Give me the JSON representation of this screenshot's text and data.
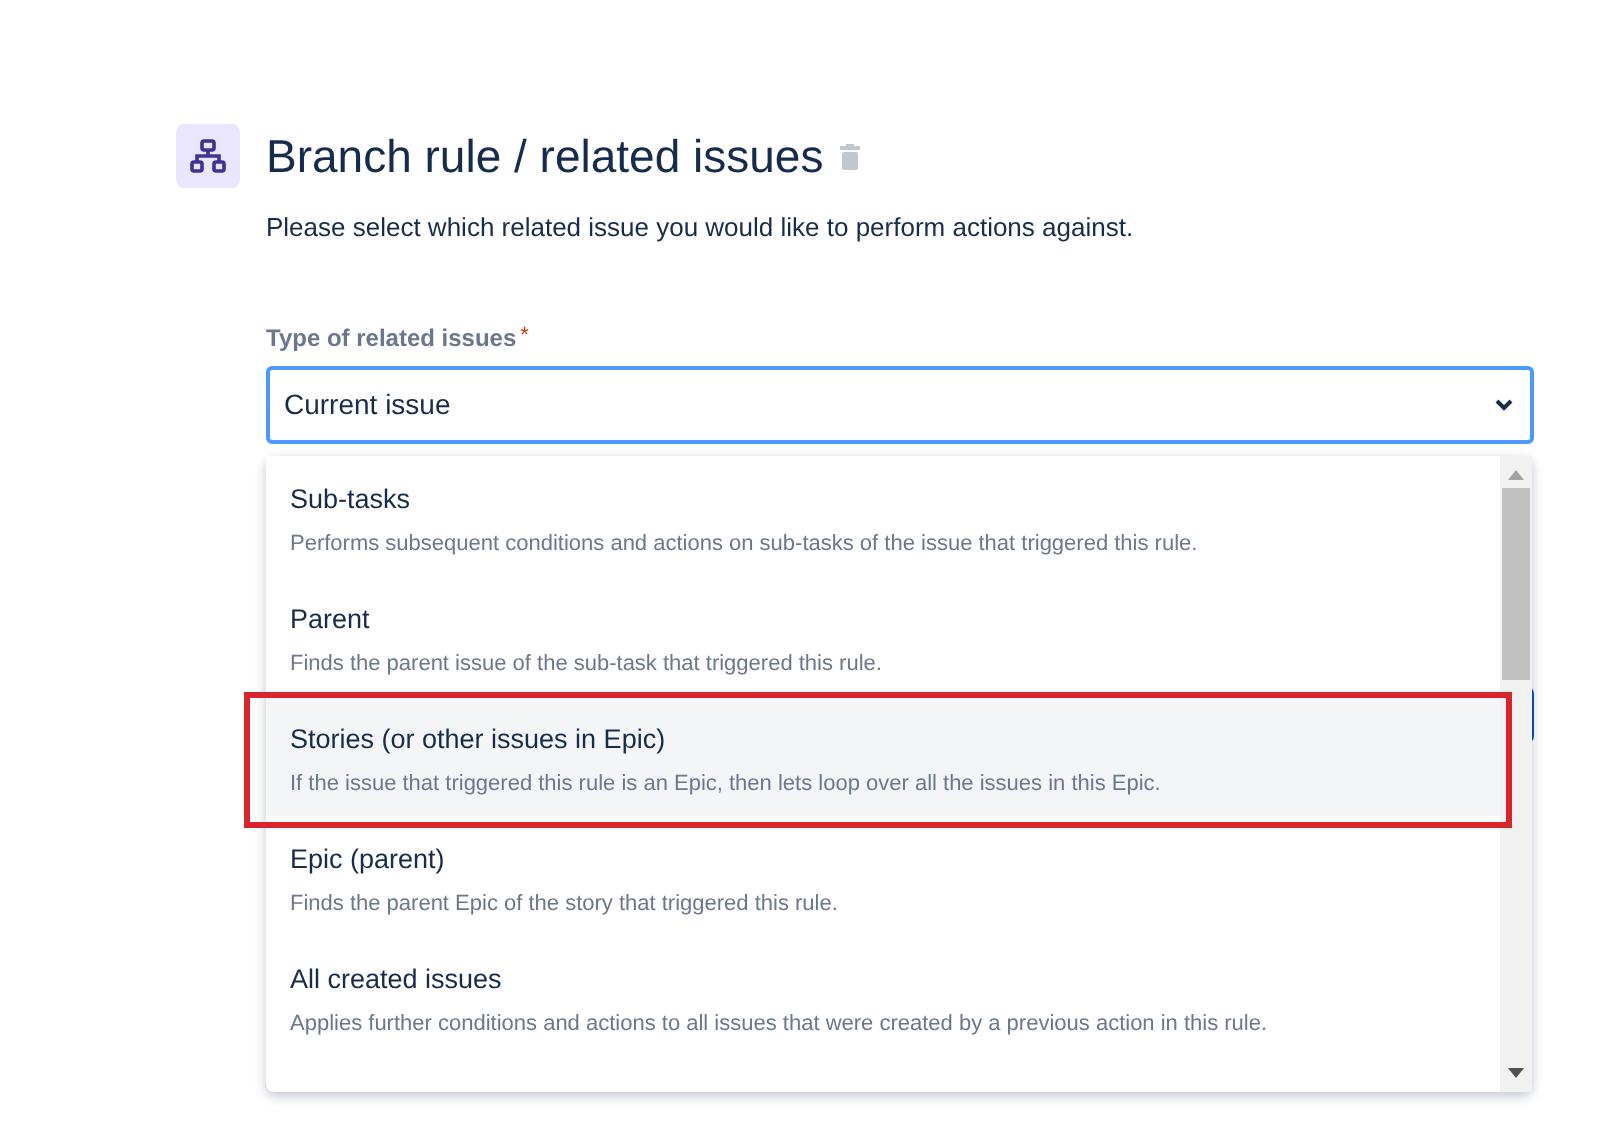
{
  "header": {
    "title": "Branch rule / related issues",
    "subtitle": "Please select which related issue you would like to perform actions against."
  },
  "field": {
    "label": "Type of related issues",
    "required_mark": "*",
    "value": "Current issue",
    "focused": true
  },
  "dropdown": {
    "options": [
      {
        "title": "Sub-tasks",
        "description": "Performs subsequent conditions and actions on sub-tasks of the issue that triggered this rule.",
        "hovered": false,
        "outlined": false
      },
      {
        "title": "Parent",
        "description": "Finds the parent issue of the sub-task that triggered this rule.",
        "hovered": false,
        "outlined": false
      },
      {
        "title": "Stories (or other issues in Epic)",
        "description": "If the issue that triggered this rule is an Epic, then lets loop over all the issues in this Epic.",
        "hovered": true,
        "outlined": true
      },
      {
        "title": "Epic (parent)",
        "description": "Finds the parent Epic of the story that triggered this rule.",
        "hovered": false,
        "outlined": false
      },
      {
        "title": "All created issues",
        "description": "Applies further conditions and actions to all issues that were created by a previous action in this rule.",
        "hovered": false,
        "outlined": false
      }
    ]
  }
}
